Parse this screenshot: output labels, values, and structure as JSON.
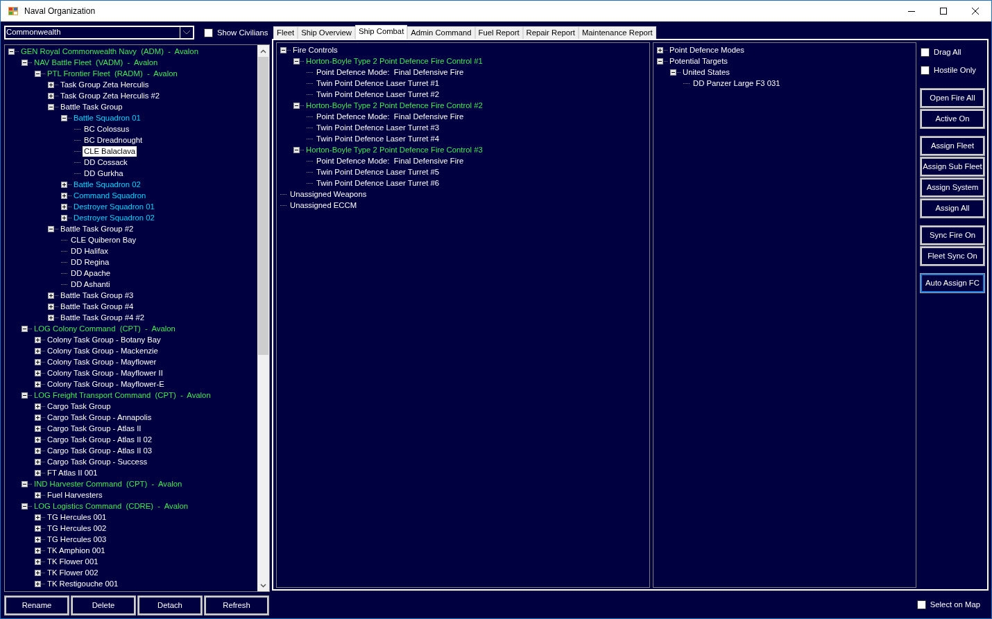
{
  "window": {
    "title": "Naval Organization"
  },
  "fleet_selector": {
    "value": "Commonwealth"
  },
  "show_civilians": {
    "label": "Show Civilians",
    "checked": false
  },
  "fleet_tree": [
    {
      "text": "GEN Royal Commonwealth Navy  (ADM)  -  Avalon",
      "kind": "command",
      "expanded": true,
      "selected": false,
      "children": [
        {
          "text": "NAV Battle Fleet  (VADM)  -  Avalon",
          "kind": "command",
          "expanded": true,
          "selected": false,
          "children": [
            {
              "text": "PTL Frontier Fleet  (RADM)  -  Avalon",
              "kind": "command",
              "expanded": true,
              "selected": false,
              "children": [
                {
                  "text": "Task Group Zeta Herculis",
                  "kind": "unit",
                  "expanded": false,
                  "selected": false
                },
                {
                  "text": "Task Group Zeta Herculis #2",
                  "kind": "unit",
                  "expanded": false,
                  "selected": false
                },
                {
                  "text": "Battle Task Group",
                  "kind": "unit",
                  "expanded": true,
                  "selected": false,
                  "children": [
                    {
                      "text": "Battle Squadron 01",
                      "kind": "squadron",
                      "expanded": true,
                      "selected": false,
                      "children": [
                        {
                          "text": "BC Colossus",
                          "kind": "unit",
                          "selected": false
                        },
                        {
                          "text": "BC Dreadnought",
                          "kind": "unit",
                          "selected": false
                        },
                        {
                          "text": "CLE Balaclava",
                          "kind": "unit",
                          "selected": true
                        },
                        {
                          "text": "DD Cossack",
                          "kind": "unit",
                          "selected": false
                        },
                        {
                          "text": "DD Gurkha",
                          "kind": "unit",
                          "selected": false
                        }
                      ]
                    },
                    {
                      "text": "Battle Squadron 02",
                      "kind": "squadron",
                      "expanded": false,
                      "selected": false
                    },
                    {
                      "text": "Command Squadron",
                      "kind": "squadron",
                      "expanded": false,
                      "selected": false
                    },
                    {
                      "text": "Destroyer Squadron 01",
                      "kind": "squadron",
                      "expanded": false,
                      "selected": false
                    },
                    {
                      "text": "Destroyer Squadron 02",
                      "kind": "squadron",
                      "expanded": false,
                      "selected": false
                    }
                  ]
                },
                {
                  "text": "Battle Task Group #2",
                  "kind": "unit",
                  "expanded": true,
                  "selected": false,
                  "children": [
                    {
                      "text": "CLE Quiberon Bay",
                      "kind": "unit",
                      "selected": false
                    },
                    {
                      "text": "DD Halifax",
                      "kind": "unit",
                      "selected": false
                    },
                    {
                      "text": "DD Regina",
                      "kind": "unit",
                      "selected": false
                    },
                    {
                      "text": "DD Apache",
                      "kind": "unit",
                      "selected": false
                    },
                    {
                      "text": "DD Ashanti",
                      "kind": "unit",
                      "selected": false
                    }
                  ]
                },
                {
                  "text": "Battle Task Group #3",
                  "kind": "unit",
                  "expanded": false,
                  "selected": false
                },
                {
                  "text": "Battle Task Group #4",
                  "kind": "unit",
                  "expanded": false,
                  "selected": false
                },
                {
                  "text": "Battle Task Group #4 #2",
                  "kind": "unit",
                  "expanded": false,
                  "selected": false
                }
              ]
            }
          ]
        },
        {
          "text": "LOG Colony Command  (CPT)  -  Avalon",
          "kind": "command",
          "expanded": true,
          "selected": false,
          "children": [
            {
              "text": "Colony Task Group - Botany Bay",
              "kind": "unit",
              "expanded": false,
              "selected": false
            },
            {
              "text": "Colony Task Group - Mackenzie",
              "kind": "unit",
              "expanded": false,
              "selected": false
            },
            {
              "text": "Colony Task Group - Mayflower",
              "kind": "unit",
              "expanded": false,
              "selected": false
            },
            {
              "text": "Colony Task Group - Mayflower II",
              "kind": "unit",
              "expanded": false,
              "selected": false
            },
            {
              "text": "Colony Task Group - Mayflower-E",
              "kind": "unit",
              "expanded": false,
              "selected": false
            }
          ]
        },
        {
          "text": "LOG Freight Transport Command  (CPT)  -  Avalon",
          "kind": "command",
          "expanded": true,
          "selected": false,
          "children": [
            {
              "text": "Cargo Task Group",
              "kind": "unit",
              "expanded": false,
              "selected": false
            },
            {
              "text": "Cargo Task Group - Annapolis",
              "kind": "unit",
              "expanded": false,
              "selected": false
            },
            {
              "text": "Cargo Task Group - Atlas II",
              "kind": "unit",
              "expanded": false,
              "selected": false
            },
            {
              "text": "Cargo Task Group - Atlas II 02",
              "kind": "unit",
              "expanded": false,
              "selected": false
            },
            {
              "text": "Cargo Task Group - Atlas II 03",
              "kind": "unit",
              "expanded": false,
              "selected": false
            },
            {
              "text": "Cargo Task Group - Success",
              "kind": "unit",
              "expanded": false,
              "selected": false
            },
            {
              "text": "FT Atlas II 001",
              "kind": "unit",
              "expanded": false,
              "selected": false
            }
          ]
        },
        {
          "text": "IND Harvester Command  (CPT)  -  Avalon",
          "kind": "command",
          "expanded": true,
          "selected": false,
          "children": [
            {
              "text": "Fuel Harvesters",
              "kind": "unit",
              "expanded": false,
              "selected": false
            }
          ]
        },
        {
          "text": "LOG Logistics Command  (CDRE)  -  Avalon",
          "kind": "command",
          "expanded": true,
          "selected": false,
          "children": [
            {
              "text": "TG Hercules 001",
              "kind": "unit",
              "expanded": false,
              "selected": false
            },
            {
              "text": "TG Hercules 002",
              "kind": "unit",
              "expanded": false,
              "selected": false
            },
            {
              "text": "TG Hercules 003",
              "kind": "unit",
              "expanded": false,
              "selected": false
            },
            {
              "text": "TK Amphion 001",
              "kind": "unit",
              "expanded": false,
              "selected": false
            },
            {
              "text": "TK Flower 001",
              "kind": "unit",
              "expanded": false,
              "selected": false
            },
            {
              "text": "TK Flower 002",
              "kind": "unit",
              "expanded": false,
              "selected": false
            },
            {
              "text": "TK Restigouche 001",
              "kind": "unit",
              "expanded": false,
              "selected": false
            }
          ]
        }
      ]
    }
  ],
  "fleet_buttons": [
    "Rename",
    "Delete",
    "Detach",
    "Refresh"
  ],
  "tabs": [
    {
      "label": "Fleet",
      "selected": false
    },
    {
      "label": "Ship Overview",
      "selected": false
    },
    {
      "label": "Ship Combat",
      "selected": true
    },
    {
      "label": "Admin Command",
      "selected": false
    },
    {
      "label": "Fuel Report",
      "selected": false
    },
    {
      "label": "Repair Report",
      "selected": false
    },
    {
      "label": "Maintenance Report",
      "selected": false
    }
  ],
  "fire_control_tree": [
    {
      "text": "Fire Controls",
      "kind": "unit",
      "expanded": true,
      "selected": false,
      "children": [
        {
          "text": "Horton-Boyle Type 2 Point Defence Fire Control #1",
          "kind": "command",
          "expanded": true,
          "selected": false,
          "children": [
            {
              "text": "Point Defence Mode:  Final Defensive Fire",
              "kind": "unit",
              "selected": false
            },
            {
              "text": "Twin Point Defence Laser Turret #1",
              "kind": "unit",
              "selected": false
            },
            {
              "text": "Twin Point Defence Laser Turret #2",
              "kind": "unit",
              "selected": false
            }
          ]
        },
        {
          "text": "Horton-Boyle Type 2 Point Defence Fire Control #2",
          "kind": "command",
          "expanded": true,
          "selected": false,
          "children": [
            {
              "text": "Point Defence Mode:  Final Defensive Fire",
              "kind": "unit",
              "selected": false
            },
            {
              "text": "Twin Point Defence Laser Turret #3",
              "kind": "unit",
              "selected": false
            },
            {
              "text": "Twin Point Defence Laser Turret #4",
              "kind": "unit",
              "selected": false
            }
          ]
        },
        {
          "text": "Horton-Boyle Type 2 Point Defence Fire Control #3",
          "kind": "command",
          "expanded": true,
          "selected": false,
          "children": [
            {
              "text": "Point Defence Mode:  Final Defensive Fire",
              "kind": "unit",
              "selected": false
            },
            {
              "text": "Twin Point Defence Laser Turret #5",
              "kind": "unit",
              "selected": false
            },
            {
              "text": "Twin Point Defence Laser Turret #6",
              "kind": "unit",
              "selected": false
            }
          ]
        }
      ]
    },
    {
      "text": "Unassigned Weapons",
      "kind": "unit",
      "selected": false
    },
    {
      "text": "Unassigned ECCM",
      "kind": "unit",
      "selected": false
    }
  ],
  "targets_tree": [
    {
      "text": "Point Defence Modes",
      "kind": "unit",
      "expanded": false,
      "selected": false
    },
    {
      "text": "Potential Targets",
      "kind": "unit",
      "expanded": true,
      "selected": false,
      "children": [
        {
          "text": "United States",
          "kind": "unit",
          "expanded": true,
          "selected": false,
          "children": [
            {
              "text": "DD Panzer Large F3 031",
              "kind": "unit",
              "selected": false
            }
          ]
        }
      ]
    }
  ],
  "drag_all": {
    "label": "Drag All",
    "checked": false
  },
  "hostile_only": {
    "label": "Hostile Only",
    "checked": false
  },
  "action_button_groups": [
    [
      {
        "label": "Open Fire All",
        "focused": false
      },
      {
        "label": "Active On",
        "focused": false
      }
    ],
    [
      {
        "label": "Assign Fleet",
        "focused": false
      },
      {
        "label": "Assign Sub Fleet",
        "focused": false
      },
      {
        "label": "Assign System",
        "focused": false
      },
      {
        "label": "Assign All",
        "focused": false
      }
    ],
    [
      {
        "label": "Sync Fire On",
        "focused": false
      },
      {
        "label": "Fleet Sync On",
        "focused": false
      }
    ],
    [
      {
        "label": "Auto Assign FC",
        "focused": true
      }
    ]
  ],
  "select_on_map": {
    "label": "Select on Map",
    "checked": false
  }
}
